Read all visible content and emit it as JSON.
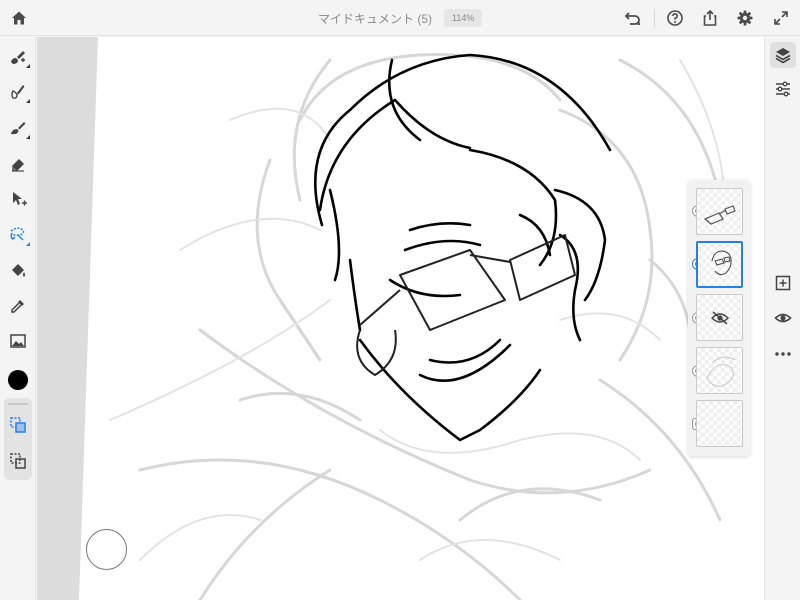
{
  "topbar": {
    "title": "マイドキュメント (5)",
    "zoom": "114%",
    "icons": [
      "home-icon",
      "undo-icon",
      "help-icon",
      "share-icon",
      "settings-icon",
      "fullscreen-icon"
    ]
  },
  "left_tools": [
    "pixel-brush",
    "live-brush",
    "vector-brush",
    "eraser",
    "transform",
    "lasso-selection",
    "fill",
    "eyedropper",
    "image",
    "color",
    "selection-add",
    "selection-subtract"
  ],
  "current_color": "#000000",
  "accent_color": "#2680eb",
  "right_tools": [
    "layers-icon",
    "layer-properties-icon",
    "add-layer-icon",
    "visibility-icon",
    "more-icon"
  ],
  "layers": [
    {
      "id": "glasses-layer",
      "selected": false,
      "hidden": false,
      "kind": "paint"
    },
    {
      "id": "line-art-layer",
      "selected": true,
      "hidden": false,
      "kind": "paint"
    },
    {
      "id": "hidden-layer",
      "selected": false,
      "hidden": true,
      "kind": "paint"
    },
    {
      "id": "sketch-layer",
      "selected": false,
      "hidden": false,
      "kind": "paint"
    },
    {
      "id": "background-layer",
      "selected": false,
      "hidden": false,
      "kind": "image"
    }
  ]
}
